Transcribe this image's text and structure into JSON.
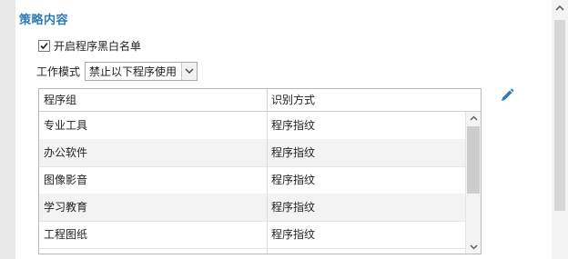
{
  "section": {
    "title": "策略内容"
  },
  "whitelist": {
    "label": "开启程序黑白名单",
    "checked": true
  },
  "mode": {
    "label": "工作模式",
    "selected": "禁止以下程序使用"
  },
  "table": {
    "columns": [
      "程序组",
      "识别方式"
    ],
    "rows": [
      {
        "group": "专业工具",
        "method": "程序指纹"
      },
      {
        "group": "办公软件",
        "method": "程序指纹"
      },
      {
        "group": "图像影音",
        "method": "程序指纹"
      },
      {
        "group": "学习教育",
        "method": "程序指纹"
      },
      {
        "group": "工程图纸",
        "method": "程序指纹"
      }
    ]
  },
  "icons": {
    "edit": "pencil-edit-icon",
    "checkbox": "checkmark-icon",
    "dropdown": "chevron-down-icon"
  },
  "colors": {
    "accent": "#2b7bbb",
    "row_alt": "#f3f3f3",
    "background": "#ececec"
  }
}
